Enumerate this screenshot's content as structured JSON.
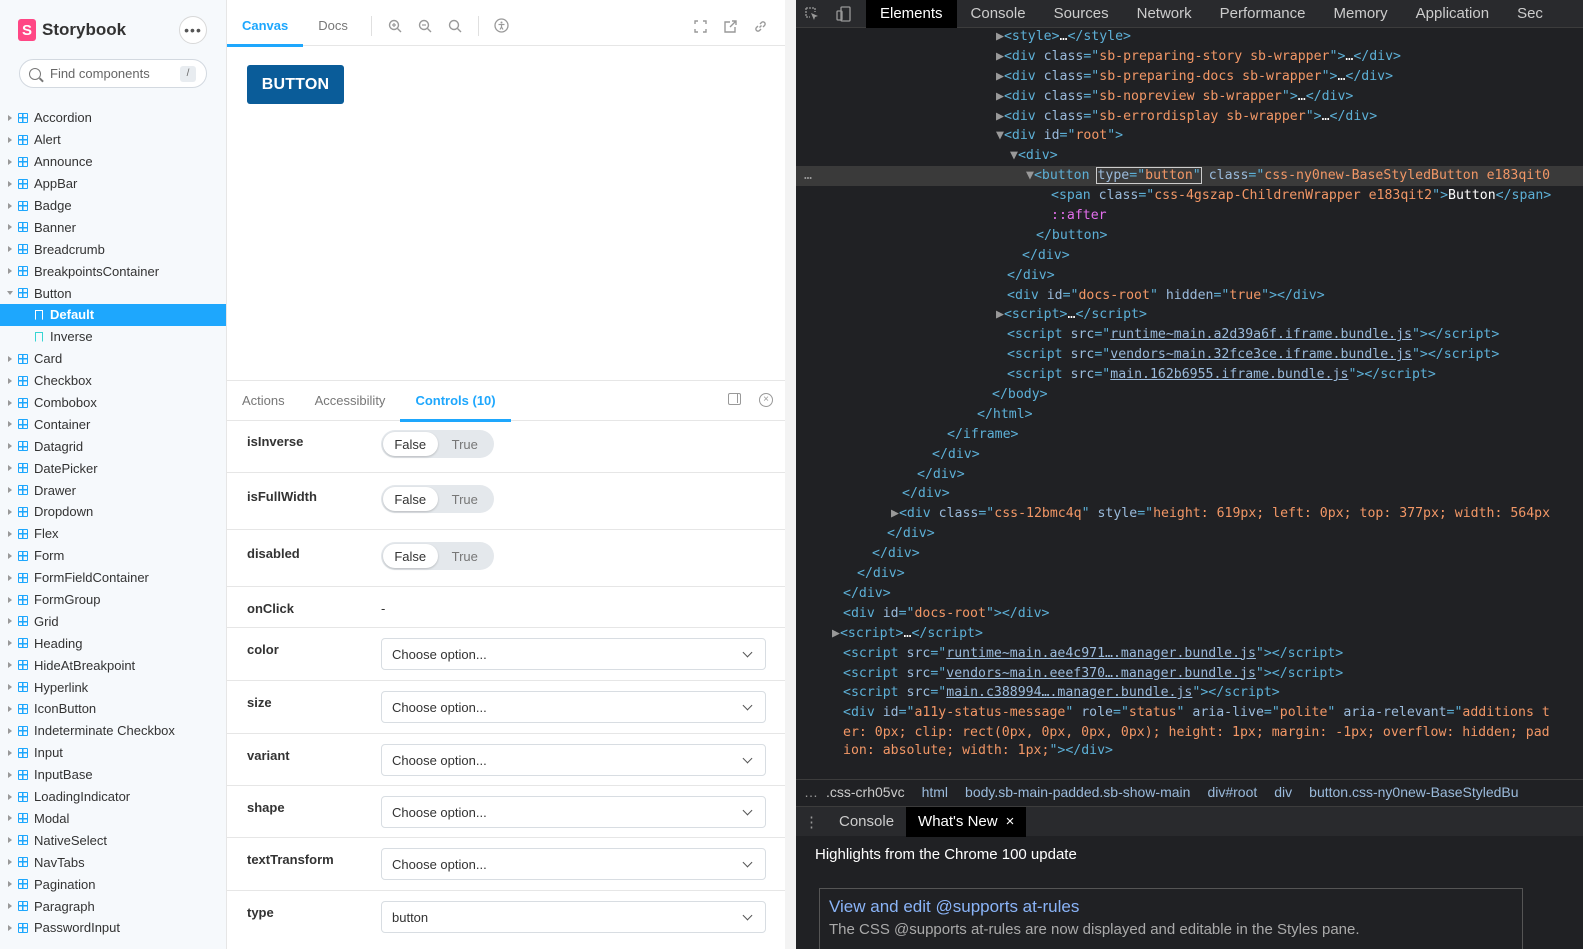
{
  "sidebar": {
    "brand": "Storybook",
    "logo_letter": "S",
    "search_placeholder": "Find components",
    "search_shortcut": "/",
    "items": [
      {
        "label": "Accordion",
        "type": "component"
      },
      {
        "label": "Alert",
        "type": "component"
      },
      {
        "label": "Announce",
        "type": "component"
      },
      {
        "label": "AppBar",
        "type": "component"
      },
      {
        "label": "Badge",
        "type": "component"
      },
      {
        "label": "Banner",
        "type": "component"
      },
      {
        "label": "Breadcrumb",
        "type": "component"
      },
      {
        "label": "BreakpointsContainer",
        "type": "component"
      },
      {
        "label": "Button",
        "type": "component-open"
      },
      {
        "label": "Default",
        "type": "story-selected"
      },
      {
        "label": "Inverse",
        "type": "story"
      },
      {
        "label": "Card",
        "type": "component"
      },
      {
        "label": "Checkbox",
        "type": "component"
      },
      {
        "label": "Combobox",
        "type": "component"
      },
      {
        "label": "Container",
        "type": "component"
      },
      {
        "label": "Datagrid",
        "type": "component"
      },
      {
        "label": "DatePicker",
        "type": "component"
      },
      {
        "label": "Drawer",
        "type": "component"
      },
      {
        "label": "Dropdown",
        "type": "component"
      },
      {
        "label": "Flex",
        "type": "component"
      },
      {
        "label": "Form",
        "type": "component"
      },
      {
        "label": "FormFieldContainer",
        "type": "component"
      },
      {
        "label": "FormGroup",
        "type": "component"
      },
      {
        "label": "Grid",
        "type": "component"
      },
      {
        "label": "Heading",
        "type": "component"
      },
      {
        "label": "HideAtBreakpoint",
        "type": "component"
      },
      {
        "label": "Hyperlink",
        "type": "component"
      },
      {
        "label": "IconButton",
        "type": "component"
      },
      {
        "label": "Indeterminate Checkbox",
        "type": "component"
      },
      {
        "label": "Input",
        "type": "component"
      },
      {
        "label": "InputBase",
        "type": "component"
      },
      {
        "label": "LoadingIndicator",
        "type": "component"
      },
      {
        "label": "Modal",
        "type": "component"
      },
      {
        "label": "NativeSelect",
        "type": "component"
      },
      {
        "label": "NavTabs",
        "type": "component"
      },
      {
        "label": "Pagination",
        "type": "component"
      },
      {
        "label": "Paragraph",
        "type": "component"
      },
      {
        "label": "PasswordInput",
        "type": "component"
      }
    ]
  },
  "toolbar": {
    "tab_canvas": "Canvas",
    "tab_docs": "Docs"
  },
  "preview": {
    "button_label": "BUTTON"
  },
  "addons": {
    "tab_actions": "Actions",
    "tab_accessibility": "Accessibility",
    "tab_controls": "Controls (10)",
    "controls": {
      "isInverse": {
        "name": "isInverse",
        "false": "False",
        "true": "True"
      },
      "isFullWidth": {
        "name": "isFullWidth",
        "false": "False",
        "true": "True"
      },
      "disabled": {
        "name": "disabled",
        "false": "False",
        "true": "True"
      },
      "onClick": {
        "name": "onClick",
        "value": "-"
      },
      "color": {
        "name": "color",
        "value": "Choose option..."
      },
      "size": {
        "name": "size",
        "value": "Choose option..."
      },
      "variant": {
        "name": "variant",
        "value": "Choose option..."
      },
      "shape": {
        "name": "shape",
        "value": "Choose option..."
      },
      "textTransform": {
        "name": "textTransform",
        "value": "Choose option..."
      },
      "type": {
        "name": "type",
        "value": "button"
      }
    }
  },
  "devtools": {
    "tabs": [
      "Elements",
      "Console",
      "Sources",
      "Network",
      "Performance",
      "Memory",
      "Application",
      "Sec"
    ],
    "breadcrumbs": [
      ".css-crh05vc",
      "html",
      "body.sb-main-padded.sb-show-main",
      "div#root",
      "div",
      "button.css-ny0new-BaseStyledBu"
    ],
    "drawer_tabs": {
      "console": "Console",
      "whats_new": "What's New",
      "close": "×"
    },
    "whats_new": {
      "heading": "Highlights from the Chrome 100 update",
      "card_title": "View and edit @supports at-rules",
      "card_desc": "The CSS @supports at-rules are now displayed and editable in the Styles pane."
    }
  },
  "colors": {
    "accent": "#1ea7fd",
    "button_bg": "#0a5c99",
    "brand": "#ff4785"
  }
}
